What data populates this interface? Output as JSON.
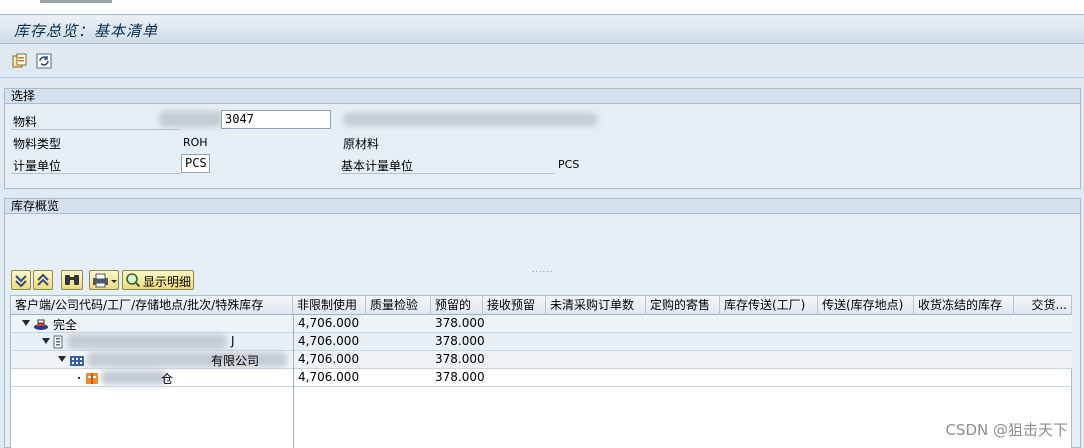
{
  "window": {
    "title": "库存总览：基本清单"
  },
  "toolbar": {
    "icons": [
      "copy-icon",
      "refresh-icon"
    ]
  },
  "selection": {
    "group_title": "选择",
    "material": {
      "label": "物料",
      "value": "3047"
    },
    "material_type": {
      "label": "物料类型",
      "value": "ROH",
      "description": "原材料"
    },
    "uom": {
      "label": "计量单位",
      "value": "PCS",
      "base_label": "基本计量单位",
      "base_value": "PCS"
    }
  },
  "overview": {
    "group_title": "库存概览",
    "splitter": "......",
    "buttons": {
      "show_detail": "显示明细"
    },
    "columns": [
      "客户端/公司代码/工厂/存储地点/批次/特殊库存",
      "非限制使用",
      "质量检验",
      "预留的",
      "接收预留",
      "未清采购订单数",
      "定购的寄售",
      "库存传送(工厂)",
      "传送(库存地点)",
      "收货冻结的库存",
      "交货..."
    ],
    "rows": [
      {
        "label": "完全",
        "unrestricted": "4,706.000",
        "reserved": "378.000"
      },
      {
        "label": "J",
        "unrestricted": "4,706.000",
        "reserved": "378.000"
      },
      {
        "label": "有限公司",
        "unrestricted": "4,706.000",
        "reserved": "378.000"
      },
      {
        "label": "仓",
        "unrestricted": "4,706.000",
        "reserved": "378.000"
      }
    ]
  },
  "watermark": "CSDN @狙击天下"
}
